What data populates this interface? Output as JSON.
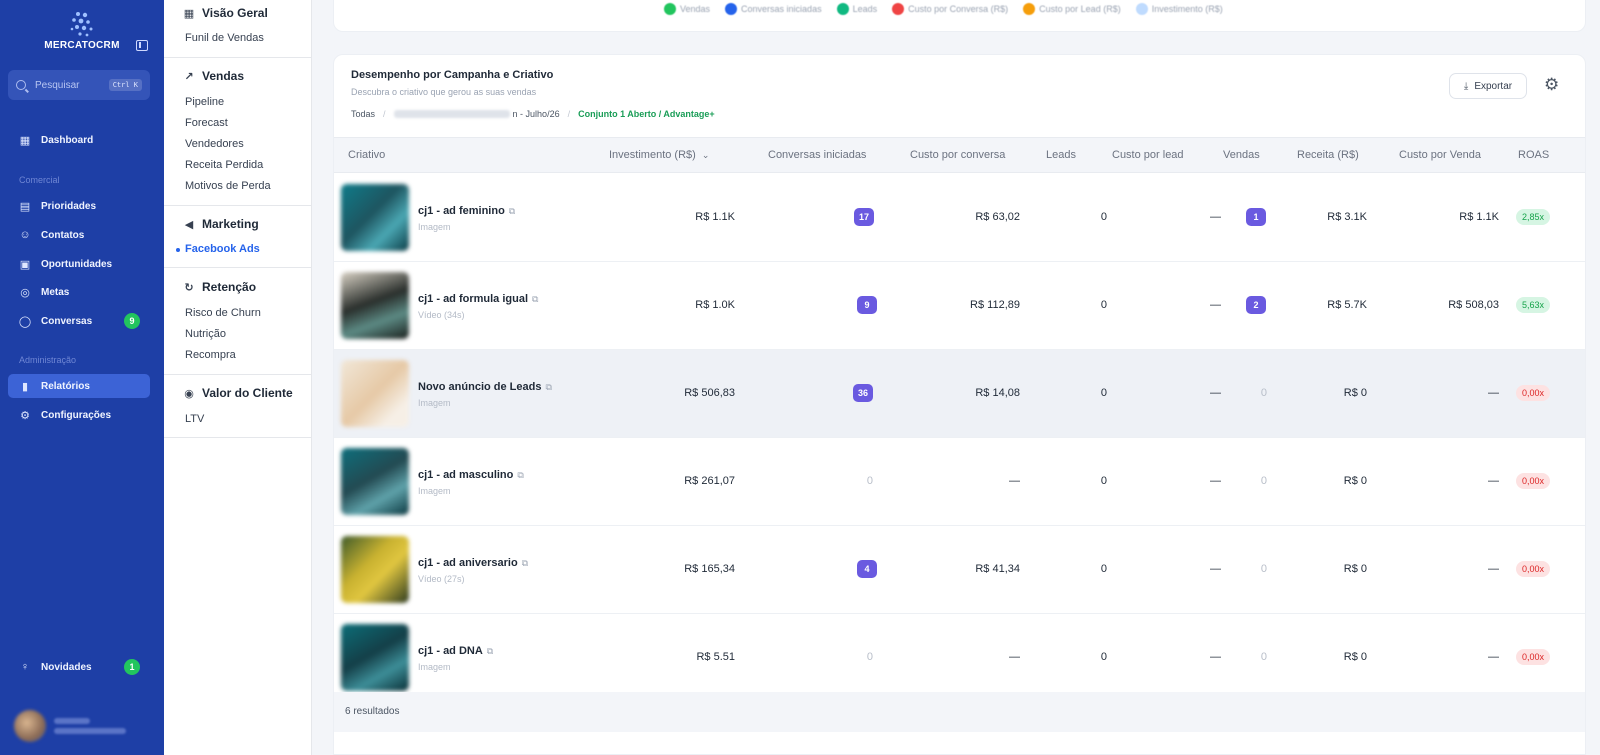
{
  "app": {
    "brand": "MERCATOCRM",
    "search_placeholder": "Pesquisar",
    "search_shortcut": "Ctrl K"
  },
  "sidebar": {
    "dashboard": "Dashboard",
    "section_comercial": "Comercial",
    "comercial_items": [
      {
        "label": "Prioridades",
        "icon": "clipboard-icon"
      },
      {
        "label": "Contatos",
        "icon": "users-icon"
      },
      {
        "label": "Oportunidades",
        "icon": "bag-icon"
      },
      {
        "label": "Metas",
        "icon": "target-icon"
      },
      {
        "label": "Conversas",
        "icon": "chat-icon",
        "badge": "9"
      }
    ],
    "section_admin": "Administração",
    "admin_items": [
      {
        "label": "Relatórios",
        "icon": "bar-chart-icon"
      },
      {
        "label": "Configurações",
        "icon": "gear-icon"
      }
    ],
    "novidades": "Novidades",
    "novidades_badge": "1"
  },
  "subnav": {
    "visao_geral": "Visão Geral",
    "visao_items": [
      "Funil de Vendas"
    ],
    "vendas": "Vendas",
    "vendas_items": [
      "Pipeline",
      "Forecast",
      "Vendedores",
      "Receita Perdida",
      "Motivos de Perda"
    ],
    "marketing": "Marketing",
    "marketing_items": [
      "Facebook Ads"
    ],
    "retencao": "Retenção",
    "retencao_items": [
      "Risco de Churn",
      "Nutrição",
      "Recompra"
    ],
    "valor": "Valor do Cliente",
    "valor_items": [
      "LTV"
    ]
  },
  "legend": [
    {
      "label": "Vendas",
      "color": "#22c55e"
    },
    {
      "label": "Conversas iniciadas",
      "color": "#2563eb"
    },
    {
      "label": "Leads",
      "color": "#10b981"
    },
    {
      "label": "Custo por Conversa (R$)",
      "color": "#ef4444"
    },
    {
      "label": "Custo por Lead (R$)",
      "color": "#f59e0b"
    },
    {
      "label": "Investimento (R$)",
      "color": "#bfdbfe"
    }
  ],
  "card": {
    "title": "Desempenho por Campanha e Criativo",
    "subtitle": "Descubra o criativo que gerou as suas vendas",
    "crumbs": {
      "root": "Todas",
      "middle_suffix": "n - Julho/26",
      "active": "Conjunto 1 Aberto / Advantage+"
    },
    "export_label": "Exportar"
  },
  "table": {
    "headers": [
      "Criativo",
      "Investimento (R$)",
      "Conversas iniciadas",
      "Custo por conversa",
      "Leads",
      "Custo por lead",
      "Vendas",
      "Receita (R$)",
      "Custo por Venda",
      "ROAS"
    ],
    "rows": [
      {
        "name": "cj1 - ad feminino",
        "type": "Imagem",
        "invest": "R$ 1.1K",
        "conv": "17",
        "conv_pill": true,
        "cpc": "R$ 63,02",
        "leads": "0",
        "cpl": "—",
        "vendas": "1",
        "vendas_pill": true,
        "receita": "R$ 3.1K",
        "cpv": "R$ 1.1K",
        "roas": "2,85x",
        "roas_good": true
      },
      {
        "name": "cj1 - ad formula igual",
        "type": "Vídeo (34s)",
        "invest": "R$ 1.0K",
        "conv": "9",
        "conv_pill": true,
        "cpc": "R$ 112,89",
        "leads": "0",
        "cpl": "—",
        "vendas": "2",
        "vendas_pill": true,
        "receita": "R$ 5.7K",
        "cpv": "R$ 508,03",
        "roas": "5,63x",
        "roas_good": true
      },
      {
        "name": "Novo anúncio de Leads",
        "type": "Imagem",
        "invest": "R$ 506,83",
        "conv": "36",
        "conv_pill": true,
        "cpc": "R$ 14,08",
        "leads": "0",
        "cpl": "—",
        "vendas": "0",
        "vendas_pill": false,
        "receita": "R$ 0",
        "cpv": "—",
        "roas": "0,00x",
        "roas_good": false
      },
      {
        "name": "cj1 - ad masculino",
        "type": "Imagem",
        "invest": "R$ 261,07",
        "conv": "0",
        "conv_pill": false,
        "cpc": "—",
        "leads": "0",
        "cpl": "—",
        "vendas": "0",
        "vendas_pill": false,
        "receita": "R$ 0",
        "cpv": "—",
        "roas": "0,00x",
        "roas_good": false
      },
      {
        "name": "cj1 - ad aniversario",
        "type": "Vídeo (27s)",
        "invest": "R$ 165,34",
        "conv": "4",
        "conv_pill": true,
        "cpc": "R$ 41,34",
        "leads": "0",
        "cpl": "—",
        "vendas": "0",
        "vendas_pill": false,
        "receita": "R$ 0",
        "cpv": "—",
        "roas": "0,00x",
        "roas_good": false
      },
      {
        "name": "cj1 - ad DNA",
        "type": "Imagem",
        "invest": "R$ 5.51",
        "conv": "0",
        "conv_pill": false,
        "cpc": "—",
        "leads": "0",
        "cpl": "—",
        "vendas": "0",
        "vendas_pill": false,
        "receita": "R$ 0",
        "cpv": "—",
        "roas": "0,00x",
        "roas_good": false
      }
    ],
    "footer": "6 resultados"
  }
}
